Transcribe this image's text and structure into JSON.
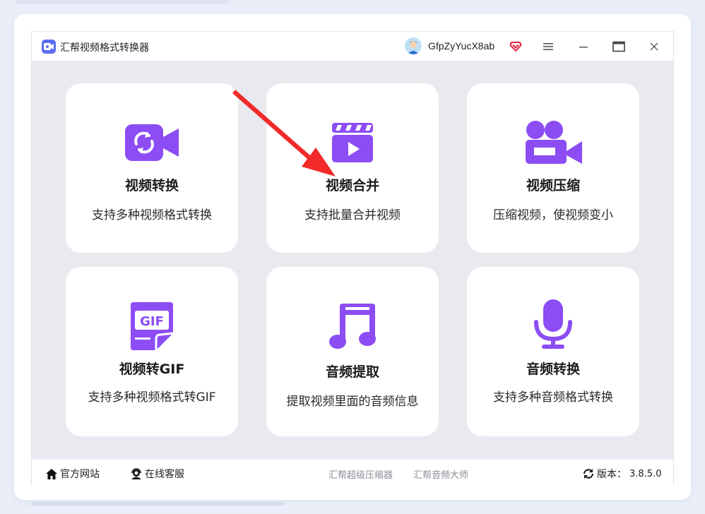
{
  "app": {
    "title": "汇帮视频格式转换器",
    "username": "GfpZyYucX8ab"
  },
  "titlebar": {
    "menu_icon": "menu-icon",
    "minimize_icon": "minimize-icon",
    "maximize_icon": "maximize-icon",
    "close_icon": "close-icon"
  },
  "features": [
    {
      "title": "视频转换",
      "desc": "支持多种视频格式转换",
      "icon": "video-convert-icon"
    },
    {
      "title": "视频合并",
      "desc": "支持批量合并视频",
      "icon": "video-merge-icon"
    },
    {
      "title": "视频压缩",
      "desc": "压缩视频，使视频变小",
      "icon": "video-compress-icon"
    },
    {
      "title": "视频转GIF",
      "desc": "支持多种视频格式转GIF",
      "icon": "gif-icon"
    },
    {
      "title": "音频提取",
      "desc": "提取视频里面的音频信息",
      "icon": "music-note-icon"
    },
    {
      "title": "音频转换",
      "desc": "支持多种音频格式转换",
      "icon": "microphone-icon"
    }
  ],
  "footer": {
    "website": "官方网站",
    "support": "在线客服",
    "link1": "汇帮超级压缩器",
    "link2": "汇帮音频大师",
    "version_label": "版本：",
    "version": "3.8.5.0"
  },
  "colors": {
    "accent": "#8c4df4",
    "arrow": "#f22a2a",
    "content_bg": "#e9eaef"
  }
}
